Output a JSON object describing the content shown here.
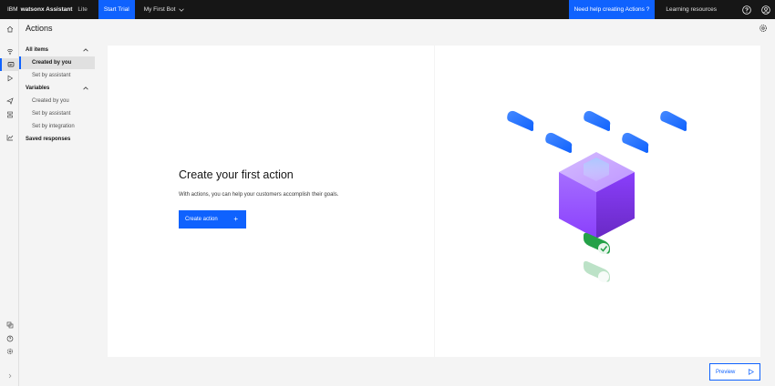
{
  "topbar": {
    "brand_ibm": "IBM",
    "brand_product": "watsonx Assistant",
    "brand_plan": "Lite",
    "start_trial": "Start Trial",
    "bot_name": "My First Bot",
    "need_help": "Need help creating Actions ?",
    "learning_resources": "Learning resources",
    "help_icon": "help-icon",
    "user_icon": "user-avatar-icon"
  },
  "page": {
    "title": "Actions"
  },
  "subnav": {
    "groups": [
      {
        "label": "All items",
        "items": [
          "Created by you",
          "Set by assistant"
        ]
      },
      {
        "label": "Variables",
        "items": [
          "Created by you",
          "Set by assistant",
          "Set by integration"
        ]
      },
      {
        "label": "Saved responses",
        "items": []
      }
    ]
  },
  "empty_state": {
    "title": "Create your first action",
    "description": "With actions, you can help your customers accomplish their goals.",
    "create_button": "Create action",
    "plus": "+"
  },
  "footer": {
    "preview_button": "Preview"
  },
  "colors": {
    "accent": "#0f62fe",
    "topbar": "#161616",
    "cube": "#8a3ffc",
    "check": "#24a148"
  }
}
